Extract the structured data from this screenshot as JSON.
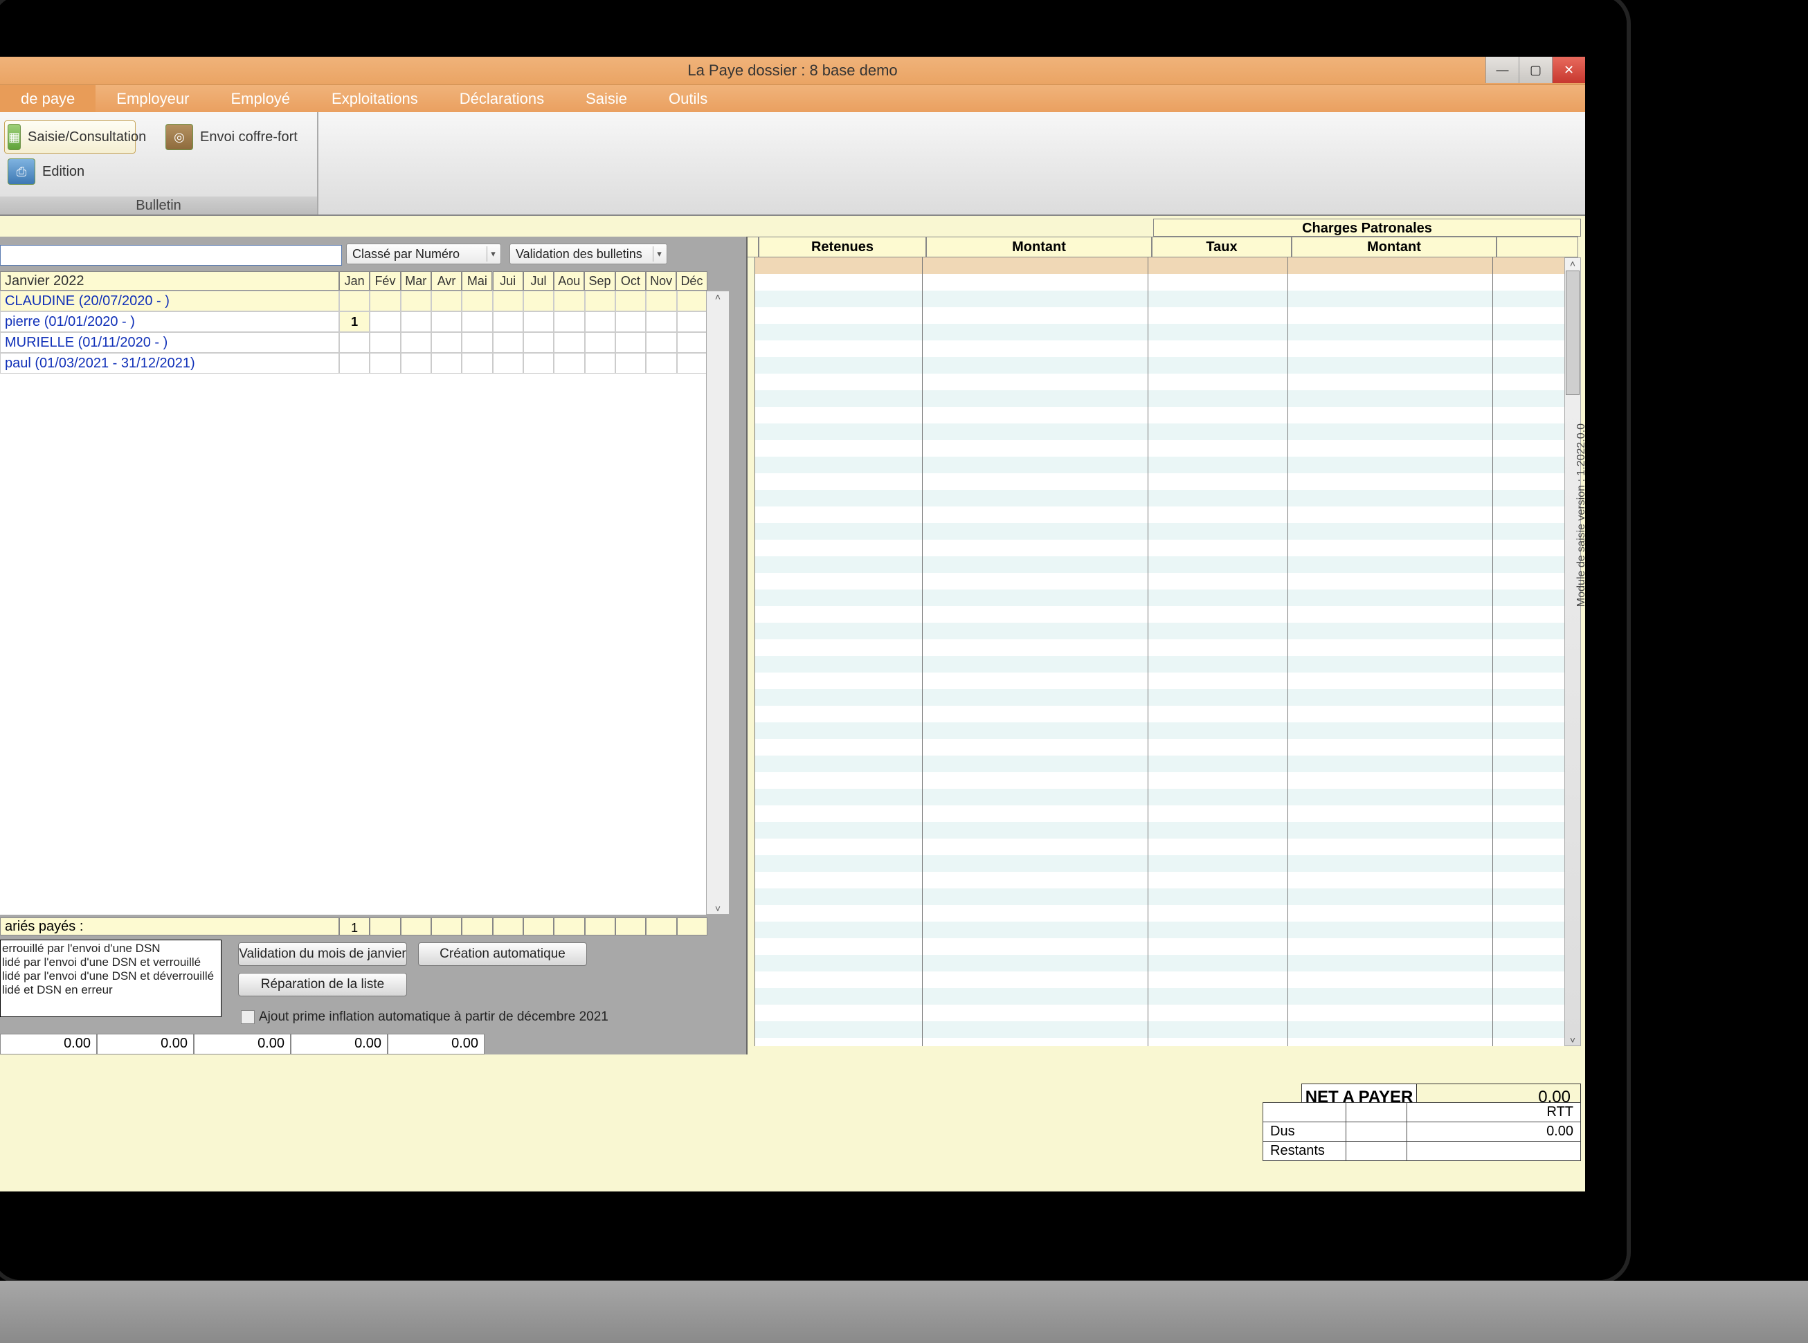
{
  "window": {
    "title": "La Paye    dossier : 8 base demo"
  },
  "tabs": [
    "de paye",
    "Employeur",
    "Employé",
    "Exploitations",
    "Déclarations",
    "Saisie",
    "Outils"
  ],
  "ribbon": {
    "group_label": "Bulletin",
    "btn_saisie": "Saisie/Consultation",
    "btn_edition": "Edition",
    "btn_coffre": "Envoi coffre-fort"
  },
  "cols": {
    "charges_patronales": "Charges Patronales",
    "rossaiale": "",
    "retenues": "Retenues",
    "montant": "Montant",
    "taux": "Taux",
    "montant2": "Montant"
  },
  "filters": {
    "classe": "Classé par Numéro",
    "validation": "Validation des bulletins"
  },
  "period": "Janvier 2022",
  "months": [
    "Jan",
    "Fév",
    "Mar",
    "Avr",
    "Mai",
    "Jui",
    "Jul",
    "Aou",
    "Sep",
    "Oct",
    "Nov",
    "Déc"
  ],
  "employees": [
    {
      "name": "CLAUDINE (20/07/2020 - )",
      "cells": [
        "",
        "",
        "",
        "",
        "",
        "",
        "",
        "",
        "",
        "",
        "",
        ""
      ],
      "selected": true
    },
    {
      "name": "pierre (01/01/2020 - )",
      "cells": [
        "1",
        "",
        "",
        "",
        "",
        "",
        "",
        "",
        "",
        "",
        "",
        ""
      ]
    },
    {
      "name": "MURIELLE (01/11/2020 - )",
      "cells": [
        "",
        "",
        "",
        "",
        "",
        "",
        "",
        "",
        "",
        "",
        "",
        ""
      ]
    },
    {
      "name": "paul (01/03/2021 - 31/12/2021)",
      "cells": [
        "",
        "",
        "",
        "",
        "",
        "",
        "",
        "",
        "",
        "",
        "",
        ""
      ]
    }
  ],
  "footer_label": "ariés payés :",
  "footer_cells": [
    "1",
    "",
    "",
    "",
    "",
    "",
    "",
    "",
    "",
    "",
    "",
    ""
  ],
  "buttons": {
    "valid_month": "Validation du mois de janvier",
    "creation_auto": "Création automatique",
    "reparation": "Réparation de la liste"
  },
  "prime_label": "Ajout prime inflation automatique à partir de décembre 2021",
  "dsn_legend": [
    "errouillé par l'envoi d'une DSN",
    "lidé par l'envoi d'une DSN et verrouillé",
    "lidé par l'envoi d'une DSN et déverrouillé",
    "lidé et DSN en erreur"
  ],
  "bottom_numbers": [
    "0.00",
    "0.00",
    "0.00",
    "0.00",
    "0.00"
  ],
  "netpay": {
    "label": "NET A PAYER",
    "value": "0.00"
  },
  "rtt": {
    "header": "RTT",
    "row1_label": "Dus",
    "row1_val": "0.00",
    "row2_label": "Restants",
    "row2_val": ""
  },
  "side_version": "Module de saisie version : 1.2022.0.0"
}
